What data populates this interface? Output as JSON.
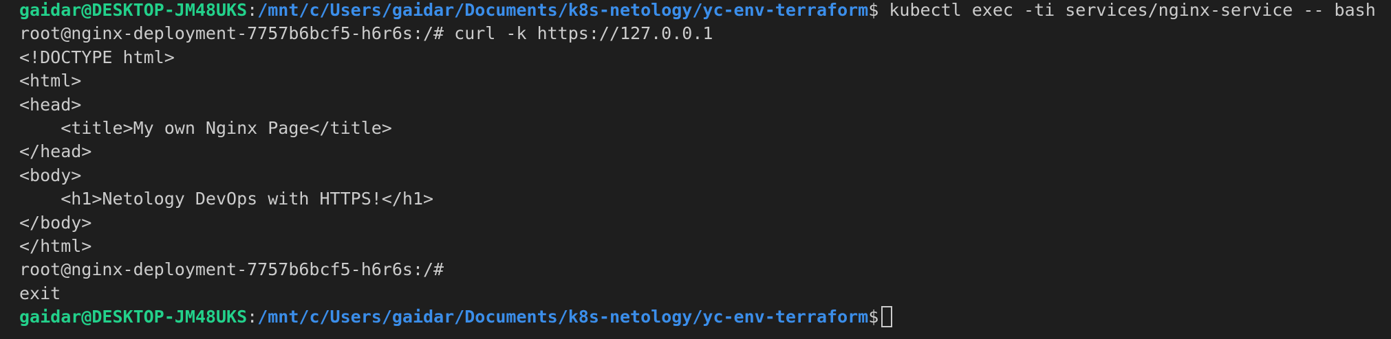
{
  "terminal": {
    "prompt1": {
      "user_host": "gaidar@DESKTOP-JM48UKS",
      "separator": ":",
      "path": "/mnt/c/Users/gaidar/Documents/k8s-netology/yc-env-terraform",
      "symbol": "$",
      "command": " kubectl exec -ti services/nginx-service -- bash"
    },
    "lines": [
      "root@nginx-deployment-7757b6bcf5-h6r6s:/# curl -k https://127.0.0.1",
      "<!DOCTYPE html>",
      "<html>",
      "<head>",
      "    <title>My own Nginx Page</title>",
      "</head>",
      "<body>",
      "    <h1>Netology DevOps with HTTPS!</h1>",
      "</body>",
      "</html>",
      "root@nginx-deployment-7757b6bcf5-h6r6s:/#",
      "exit"
    ],
    "prompt2": {
      "user_host": "gaidar@DESKTOP-JM48UKS",
      "separator": ":",
      "path": "/mnt/c/Users/gaidar/Documents/k8s-netology/yc-env-terraform",
      "symbol": "$"
    },
    "colors": {
      "background": "#1e1e1e",
      "text": "#cccccc",
      "user_host": "#23d18b",
      "path": "#3b8eea"
    }
  }
}
